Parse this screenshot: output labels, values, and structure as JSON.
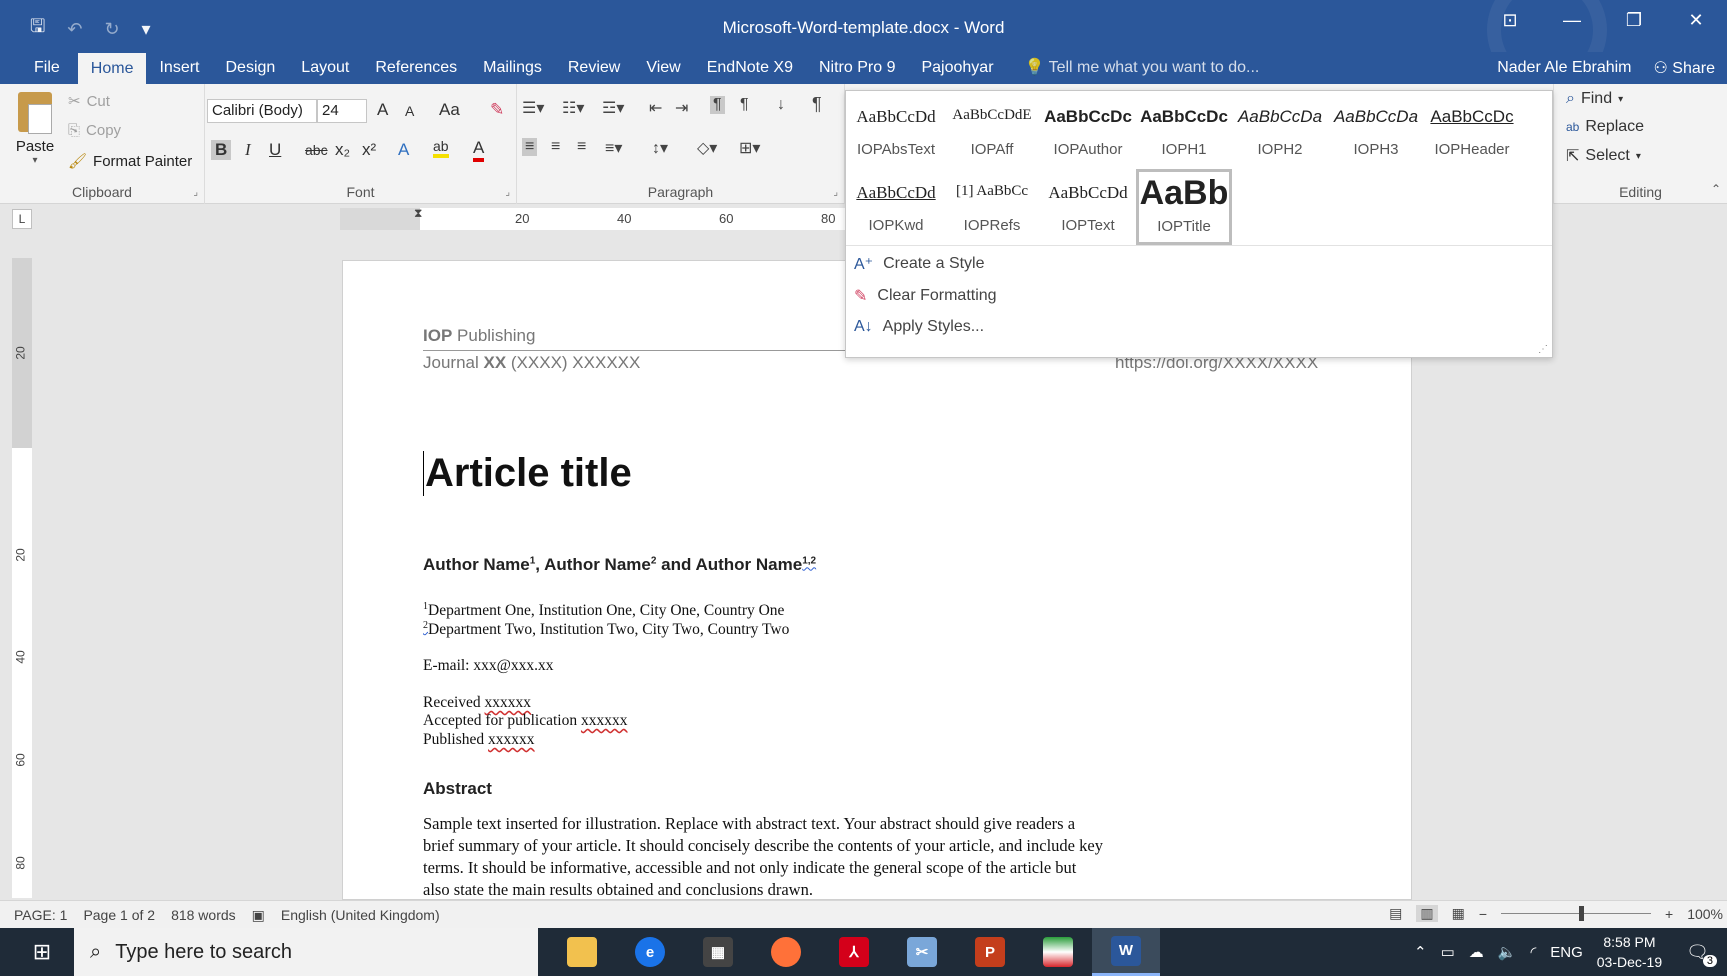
{
  "window": {
    "title": "Microsoft-Word-template.docx - Word",
    "qat": {
      "save": "🖫",
      "undo": "↶",
      "redo": "↻",
      "more": "▾"
    },
    "controls": {
      "ribbon_display": "⊡",
      "minimize": "—",
      "restore": "❐",
      "close": "✕"
    }
  },
  "tabs": [
    "File",
    "Home",
    "Insert",
    "Design",
    "Layout",
    "References",
    "Mailings",
    "Review",
    "View",
    "EndNote X9",
    "Nitro Pro 9",
    "Pajoohyar"
  ],
  "tell_me": "Tell me what you want to do...",
  "user": "Nader Ale Ebrahim",
  "share": "Share",
  "clipboard": {
    "paste": "Paste",
    "cut": "Cut",
    "copy": "Copy",
    "format_painter": "Format Painter",
    "label": "Clipboard"
  },
  "font": {
    "name": "Calibri (Body)",
    "size": "24",
    "label": "Font",
    "grow": "A",
    "shrink": "A",
    "case": "Aa",
    "bold": "B",
    "italic": "I",
    "underline": "U",
    "strike": "abc",
    "sub": "x₂",
    "sup": "x²"
  },
  "paragraph": {
    "label": "Paragraph"
  },
  "styles": [
    {
      "sample": "AaBbCcDd",
      "name": "IOPAbsText"
    },
    {
      "sample": "AaBbCcDdE",
      "name": "IOPAff"
    },
    {
      "sample": "AaBbCcDc",
      "name": "IOPAuthor"
    },
    {
      "sample": "AaBbCcDc",
      "name": "IOPH1"
    },
    {
      "sample": "AaBbCcDa",
      "name": "IOPH2"
    },
    {
      "sample": "AaBbCcDa",
      "name": "IOPH3"
    },
    {
      "sample": "AaBbCcDc",
      "name": "IOPHeader"
    },
    {
      "sample": "AaBbCcDd",
      "name": "IOPKwd"
    },
    {
      "sample": "[1]  AaBbCc",
      "name": "IOPRefs"
    },
    {
      "sample": "AaBbCcDd",
      "name": "IOPText"
    },
    {
      "sample": "AaBb",
      "name": "IOPTitle"
    }
  ],
  "style_commands": {
    "create": "Create a Style",
    "clear": "Clear Formatting",
    "apply": "Apply Styles..."
  },
  "editing": {
    "find": "Find",
    "replace": "Replace",
    "select": "Select",
    "label": "Editing"
  },
  "ruler": {
    "h": [
      "20",
      "40",
      "60",
      "80"
    ],
    "v": [
      "20",
      "20",
      "40",
      "60",
      "80"
    ]
  },
  "document": {
    "publisher_bold": "IOP",
    "publisher_rest": " Publishing",
    "journal_pre": "Journal ",
    "journal_bold": "XX",
    "journal_post": " (XXXX) XXXXXX",
    "doi": "https://doi.org/XXXX/XXXX",
    "title": "Article title",
    "authors": {
      "a1": "Author Name",
      "s1": "1",
      "a2": ", Author Name",
      "s2": "2",
      "a3": " and Author Name",
      "s3": "1,2"
    },
    "aff1_sup": "1",
    "aff1": "Department One, Institution One, City One, Country One",
    "aff2_sup": "2",
    "aff2": "Department Two, Institution Two, City Two, Country Two",
    "email": "E-mail: xxx@xxx.xx",
    "received_label": "Received ",
    "received": "xxxxxx",
    "accepted_label": "Accepted for publication ",
    "accepted": "xxxxxx",
    "published_label": "Published ",
    "published": "xxxxxx",
    "abstract_heading": "Abstract",
    "abstract": "Sample text inserted for illustration. Replace with abstract text. Your abstract should give readers a brief summary of your article. It should concisely describe the contents of your article, and include key terms. It should be informative, accessible and not only indicate the general scope of the article but also state the main results obtained and conclusions drawn."
  },
  "status": {
    "page_num": "PAGE: 1",
    "page_of": "Page 1 of 2",
    "words": "818 words",
    "language": "English (United Kingdom)",
    "zoom_minus": "−",
    "zoom_plus": "+",
    "zoom": "100%"
  },
  "taskbar": {
    "search": "Type here to search",
    "lang": "ENG",
    "time": "8:58 PM",
    "date": "03-Dec-19",
    "notif": "3"
  }
}
